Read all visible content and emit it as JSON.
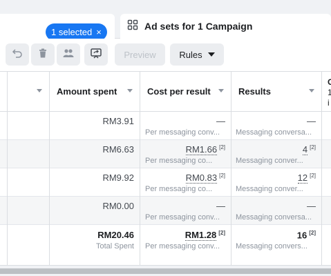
{
  "tabs": {
    "selected_label": "1 selected",
    "selected_close": "×",
    "adsets_label": "Ad sets for 1 Campaign"
  },
  "toolbar": {
    "preview_label": "Preview",
    "rules_label": "Rules"
  },
  "table": {
    "headers": {
      "amount_spent": "Amount spent",
      "cost_per_result": "Cost per result",
      "results": "Results",
      "partial_col_1": "C",
      "partial_col_2": "1",
      "partial_col_3": "i"
    },
    "rows": [
      {
        "amount_spent": "RM3.91",
        "cost_per_result": "—",
        "cost_per_result_sup": "",
        "cost_sub": "Per messaging conv...",
        "results": "—",
        "results_sup": "",
        "results_sub": "Messaging conversa..."
      },
      {
        "amount_spent": "RM6.63",
        "cost_per_result": "RM1.66",
        "cost_per_result_sup": "[2]",
        "cost_sub": "Per messaging co...",
        "results": "4",
        "results_sup": "[2]",
        "results_sub": "Messaging conver..."
      },
      {
        "amount_spent": "RM9.92",
        "cost_per_result": "RM0.83",
        "cost_per_result_sup": "[2]",
        "cost_sub": "Per messaging co...",
        "results": "12",
        "results_sup": "[2]",
        "results_sub": "Messaging conver..."
      },
      {
        "amount_spent": "RM0.00",
        "cost_per_result": "—",
        "cost_per_result_sup": "",
        "cost_sub": "Per messaging conv...",
        "results": "—",
        "results_sup": "",
        "results_sub": "Messaging conversa..."
      }
    ],
    "total": {
      "amount_spent": "RM20.46",
      "amount_sub": "Total Spent",
      "cost_per_result": "RM1.28",
      "cost_per_result_sup": "[2]",
      "cost_sub": "Per messaging conv...",
      "results": "16",
      "results_sup": "[2]",
      "results_sub": "Messaging convers..."
    }
  },
  "icons": {
    "undo": "undo-icon",
    "delete": "trash-icon",
    "audience": "people-icon",
    "share": "share-icon",
    "adsets": "grid-icon"
  }
}
